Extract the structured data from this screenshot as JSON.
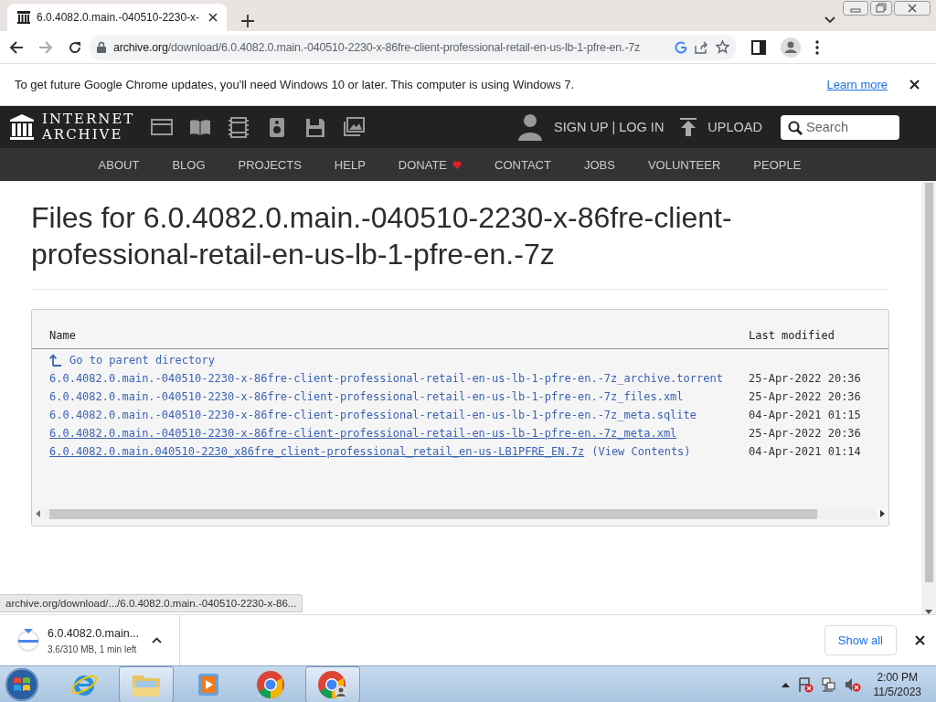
{
  "browser": {
    "tab": {
      "title": "6.0.4082.0.main.-040510-2230-x-"
    },
    "url_host": "archive.org",
    "url_path": "/download/6.0.4082.0.main.-040510-2230-x-86fre-client-professional-retail-en-us-lb-1-pfre-en.-7z"
  },
  "info_bar": {
    "message": "To get future Google Chrome updates, you'll need Windows 10 or later. This computer is using Windows 7.",
    "link": "Learn more"
  },
  "site_header": {
    "logo_lines": [
      "INTERNET",
      "ARCHIVE"
    ],
    "account": "SIGN UP | LOG IN",
    "upload": "UPLOAD",
    "search": {
      "placeholder": "Search"
    }
  },
  "nav": [
    {
      "label": "ABOUT",
      "heart": false
    },
    {
      "label": "BLOG",
      "heart": false
    },
    {
      "label": "PROJECTS",
      "heart": false
    },
    {
      "label": "HELP",
      "heart": false
    },
    {
      "label": "DONATE",
      "heart": true
    },
    {
      "label": "CONTACT",
      "heart": false
    },
    {
      "label": "JOBS",
      "heart": false
    },
    {
      "label": "VOLUNTEER",
      "heart": false
    },
    {
      "label": "PEOPLE",
      "heart": false
    }
  ],
  "page": {
    "title": "Files for 6.0.4082.0.main.-040510-2230-x-86fre-client-professional-retail-en-us-lb-1-pfre-en.-7z",
    "table": {
      "columns": [
        "Name",
        "Last modified"
      ],
      "parent_link": "Go to parent directory",
      "rows": [
        {
          "name": "6.0.4082.0.main.-040510-2230-x-86fre-client-professional-retail-en-us-lb-1-pfre-en.-7z_archive.torrent",
          "modified": "25-Apr-2022 20:36",
          "underlined": false
        },
        {
          "name": "6.0.4082.0.main.-040510-2230-x-86fre-client-professional-retail-en-us-lb-1-pfre-en.-7z_files.xml",
          "modified": "25-Apr-2022 20:36",
          "underlined": false
        },
        {
          "name": "6.0.4082.0.main.-040510-2230-x-86fre-client-professional-retail-en-us-lb-1-pfre-en.-7z_meta.sqlite",
          "modified": "04-Apr-2021 01:15",
          "underlined": false
        },
        {
          "name": "6.0.4082.0.main.-040510-2230-x-86fre-client-professional-retail-en-us-lb-1-pfre-en.-7z_meta.xml",
          "modified": "25-Apr-2022 20:36",
          "underlined": true
        },
        {
          "name": "6.0.4082.0.main.040510-2230_x86fre_client-professional_retail_en-us-LB1PFRE_EN.7z",
          "extra": "(View Contents)",
          "modified": "04-Apr-2021 01:14",
          "underlined": true
        }
      ]
    }
  },
  "status_url": "archive.org/download/.../6.0.4082.0.main.-040510-2230-x-86...",
  "download": {
    "filename": "6.0.4082.0.main...",
    "progress": "3.6/310 MB, 1 min left",
    "show_all": "Show all"
  },
  "taskbar": {
    "apps": [
      {
        "kind": "ie",
        "selected": false
      },
      {
        "kind": "explorer",
        "selected": true
      },
      {
        "kind": "media",
        "selected": false
      },
      {
        "kind": "chrome",
        "selected": false
      },
      {
        "kind": "chrome-profile",
        "selected": true
      }
    ],
    "time": "2:00 PM",
    "date": "11/5/2023"
  }
}
